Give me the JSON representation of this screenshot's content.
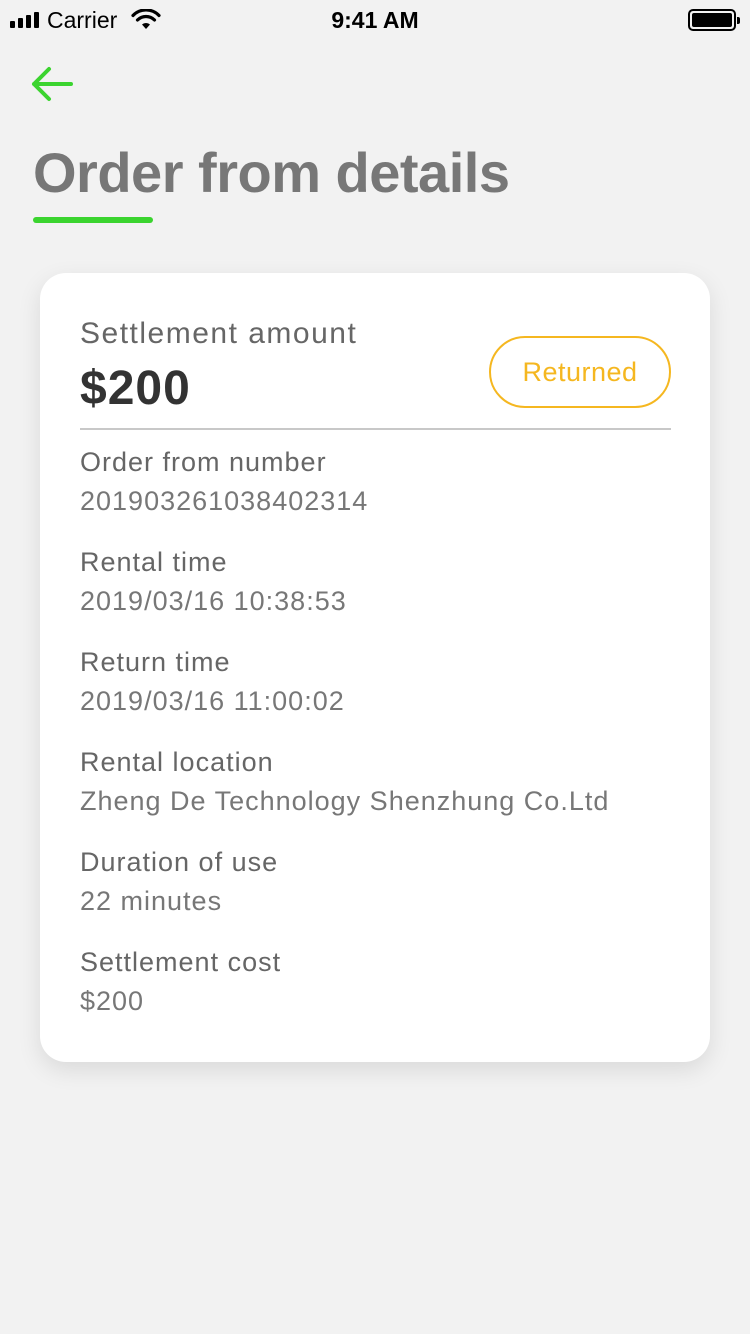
{
  "status_bar": {
    "carrier": "Carrier",
    "time": "9:41 AM"
  },
  "header": {
    "back_icon": "arrow-left-icon",
    "title": "Order from details",
    "accent_color": "#3bd42f"
  },
  "summary": {
    "amount_label": "Settlement amount",
    "amount_value": "$200",
    "status": "Returned",
    "status_color": "#f5b720"
  },
  "details": [
    {
      "label": "Order from number",
      "value": "201903261038402314"
    },
    {
      "label": "Rental time",
      "value": "2019/03/16 10:38:53"
    },
    {
      "label": "Return time",
      "value": "2019/03/16 11:00:02"
    },
    {
      "label": "Rental location",
      "value": "Zheng De Technology Shenzhung Co.Ltd"
    },
    {
      "label": "Duration of use",
      "value": "22 minutes"
    },
    {
      "label": "Settlement cost",
      "value": "$200"
    }
  ]
}
